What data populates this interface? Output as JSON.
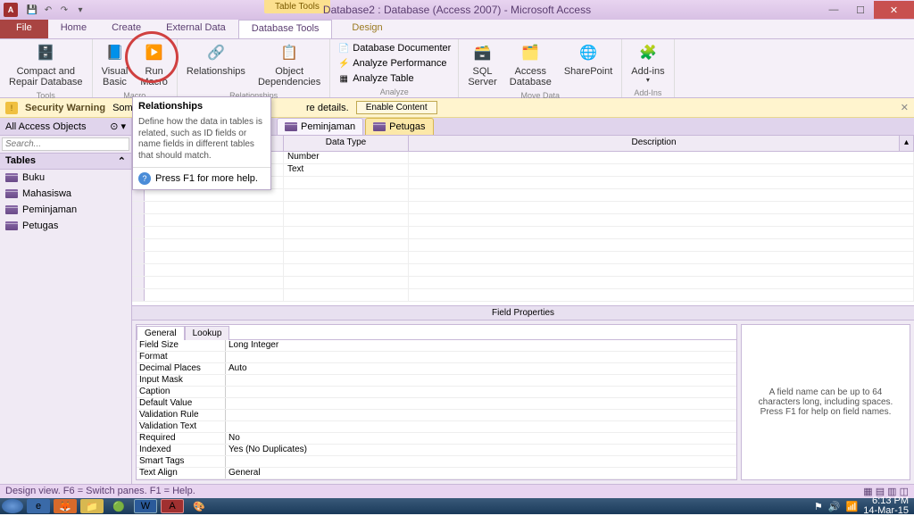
{
  "title": "Database2 : Database (Access 2007) - Microsoft Access",
  "table_tools_label": "Table Tools",
  "tabs": {
    "file": "File",
    "home": "Home",
    "create": "Create",
    "external": "External Data",
    "dbtools": "Database Tools",
    "design": "Design"
  },
  "ribbon": {
    "tools": {
      "compact": "Compact and\nRepair Database",
      "label": "Tools"
    },
    "macro": {
      "vb": "Visual\nBasic",
      "run": "Run\nMacro",
      "label": "Macro"
    },
    "relationships": {
      "rel": "Relationships",
      "dep": "Object\nDependencies",
      "label": "Relationships"
    },
    "analyze": {
      "doc": "Database Documenter",
      "perf": "Analyze Performance",
      "table": "Analyze Table",
      "label": "Analyze"
    },
    "move": {
      "sql": "SQL\nServer",
      "access": "Access\nDatabase",
      "sp": "SharePoint",
      "label": "Move Data"
    },
    "addins": {
      "addins": "Add-ins",
      "label": "Add-Ins"
    }
  },
  "security": {
    "title": "Security Warning",
    "text": "Some acti",
    "details": "re details.",
    "enable": "Enable Content"
  },
  "tooltip": {
    "title": "Relationships",
    "body": "Define how the data in tables is related, such as ID fields or name fields in different tables that should match.",
    "help": "Press F1 for more help."
  },
  "nav": {
    "header": "All Access Objects",
    "search_placeholder": "Search...",
    "section": "Tables",
    "items": [
      "Buku",
      "Mahasiswa",
      "Peminjaman",
      "Petugas"
    ]
  },
  "doc_tabs": [
    "Peminjaman",
    "Petugas"
  ],
  "grid": {
    "headers": {
      "name": "",
      "type": "Data Type",
      "desc": "Description"
    },
    "rows": [
      {
        "type": "Number"
      },
      {
        "type": "Text"
      }
    ]
  },
  "field_props_label": "Field Properties",
  "props_tabs": {
    "general": "General",
    "lookup": "Lookup"
  },
  "props": [
    {
      "label": "Field Size",
      "value": "Long Integer"
    },
    {
      "label": "Format",
      "value": ""
    },
    {
      "label": "Decimal Places",
      "value": "Auto"
    },
    {
      "label": "Input Mask",
      "value": ""
    },
    {
      "label": "Caption",
      "value": ""
    },
    {
      "label": "Default Value",
      "value": ""
    },
    {
      "label": "Validation Rule",
      "value": ""
    },
    {
      "label": "Validation Text",
      "value": ""
    },
    {
      "label": "Required",
      "value": "No"
    },
    {
      "label": "Indexed",
      "value": "Yes (No Duplicates)"
    },
    {
      "label": "Smart Tags",
      "value": ""
    },
    {
      "label": "Text Align",
      "value": "General"
    }
  ],
  "props_help": "A field name can be up to 64 characters long, including spaces. Press F1 for help on field names.",
  "status": "Design view.   F6 = Switch panes.   F1 = Help.",
  "tray": {
    "time": "6:13 PM",
    "date": "14-Mar-15"
  }
}
